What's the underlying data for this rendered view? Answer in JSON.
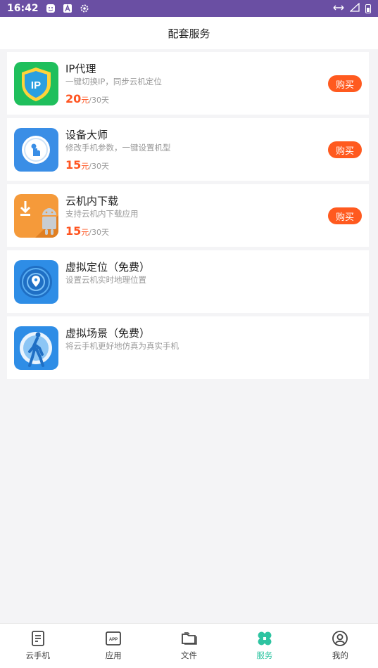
{
  "status_bar": {
    "time": "16:42"
  },
  "header": {
    "title": "配套服务"
  },
  "services": [
    {
      "title": "IP代理",
      "desc": "一键切换IP，同步云机定位",
      "price": "20",
      "unit": "元",
      "period": "/30天",
      "buy_label": "购买",
      "icon": "ip-proxy-shield-icon"
    },
    {
      "title": "设备大师",
      "desc": "修改手机参数，一键设置机型",
      "price": "15",
      "unit": "元",
      "period": "/30天",
      "buy_label": "购买",
      "icon": "device-master-icon"
    },
    {
      "title": "云机内下载",
      "desc": "支持云机内下载应用",
      "price": "15",
      "unit": "元",
      "period": "/30天",
      "buy_label": "购买",
      "icon": "android-download-icon"
    },
    {
      "title": "虚拟定位（免费）",
      "desc": "设置云机实时地理位置",
      "icon": "location-radar-icon"
    },
    {
      "title": "虚拟场景（免费）",
      "desc": "将云手机更好地仿真为真实手机",
      "icon": "walking-person-icon"
    }
  ],
  "tabs": [
    {
      "label": "云手机",
      "icon": "phone-doc-icon"
    },
    {
      "label": "应用",
      "icon": "app-icon"
    },
    {
      "label": "文件",
      "icon": "folder-icon"
    },
    {
      "label": "服务",
      "icon": "clover-icon",
      "active": true
    },
    {
      "label": "我的",
      "icon": "user-circle-icon"
    }
  ],
  "colors": {
    "status_bar": "#6a4fa3",
    "accent": "#2ec4a1",
    "buy": "#ff5a1f",
    "price": "#ff5521"
  }
}
